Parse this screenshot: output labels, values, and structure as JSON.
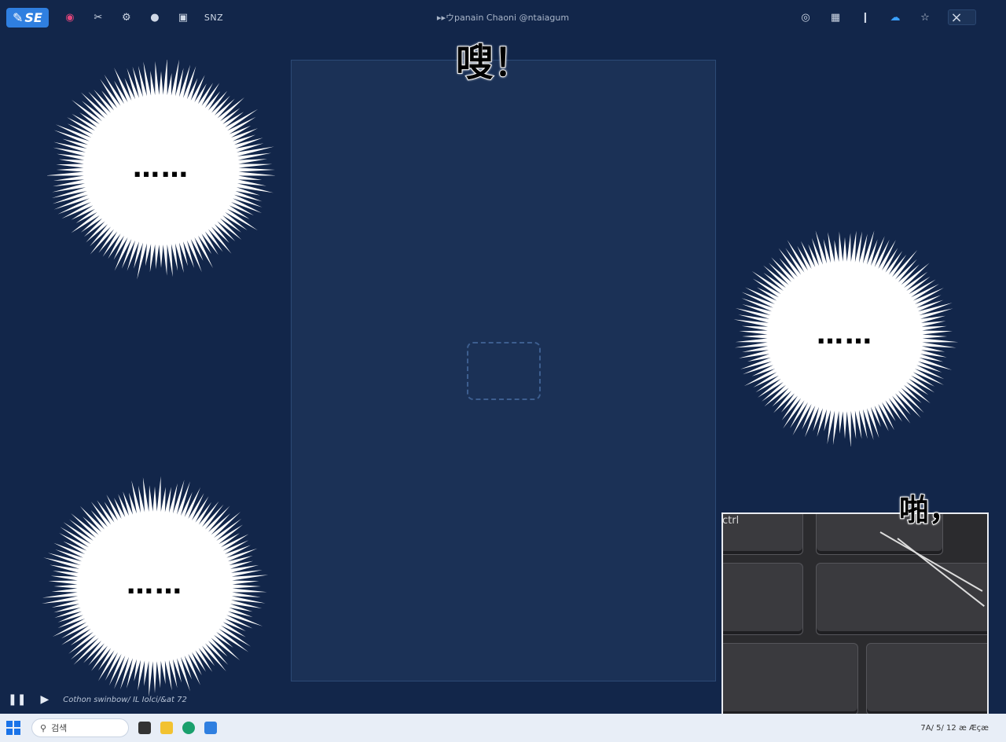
{
  "toolbar": {
    "badge_label": "SE",
    "title": "▸▸ウpanain Chaoni @ntaiagum",
    "text_item": "SNZ",
    "left_icons": [
      "camera-icon",
      "scissors-icon",
      "settings-icon",
      "wifi-icon",
      "record-icon"
    ],
    "right_icons": [
      "target-icon",
      "grid-icon",
      "pin-icon",
      "cloud-icon",
      "star-icon"
    ],
    "close_label": "×"
  },
  "main_art": {
    "status": "placeholder"
  },
  "bursts": [
    {
      "text": "……"
    },
    {
      "text": "……"
    },
    {
      "text": "……"
    }
  ],
  "sfx": {
    "top": "嗖！",
    "inset": "啪，"
  },
  "inset": {
    "key_label": "ctrl",
    "keys": [
      "key-a",
      "key-b",
      "key-c",
      "key-d"
    ]
  },
  "playbar": {
    "pause_label": "❚❚",
    "play_label": "▶",
    "info_text": "Cothon swinbow/ IL Iolci/&at 72"
  },
  "taskbar": {
    "search_placeholder": "검색",
    "tray_text": "7A/ 5/ 12  æ Æçæ",
    "colors": {
      "accent": "#1a73e8",
      "bg": "#12264a"
    }
  }
}
